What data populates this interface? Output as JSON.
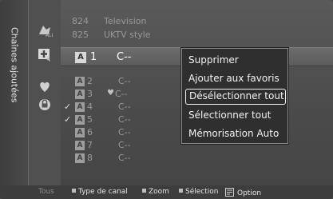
{
  "sidebar": {
    "tab_label": "Chaînes ajoutées"
  },
  "icons": {
    "all": "all-channels-icon",
    "add": "add-channel-icon",
    "favorite": "heart-icon",
    "lock": "lock-icon"
  },
  "previous": [
    {
      "num": "824",
      "name": "Television"
    },
    {
      "num": "825",
      "name": "UKTV style"
    }
  ],
  "selected": {
    "badge": "A",
    "num": "1",
    "name": "C--"
  },
  "channels": [
    {
      "check": "",
      "badge": "A",
      "num": "2",
      "name": "C--",
      "fav": false
    },
    {
      "check": "",
      "badge": "A",
      "num": "3",
      "name": "C--",
      "fav": true
    },
    {
      "check": "✓",
      "badge": "A",
      "num": "4",
      "name": "C--",
      "fav": false
    },
    {
      "check": "✓",
      "badge": "A",
      "num": "5",
      "name": "C--",
      "fav": false
    },
    {
      "check": "",
      "badge": "A",
      "num": "6",
      "name": "C--",
      "fav": false
    },
    {
      "check": "",
      "badge": "A",
      "num": "7",
      "name": "C--",
      "fav": false
    },
    {
      "check": "",
      "badge": "A",
      "num": "8",
      "name": "C--",
      "fav": false
    }
  ],
  "menu": {
    "items": [
      "Supprimer",
      "Ajouter aux favoris",
      "Désélectionner tout",
      "Sélectionner tout",
      "Mémorisation Auto"
    ],
    "focused_index": 2
  },
  "footer": {
    "filter": "Tous",
    "channel_type": "Type de canal",
    "zoom": "Zoom",
    "select": "Sélection",
    "option": "Option"
  }
}
